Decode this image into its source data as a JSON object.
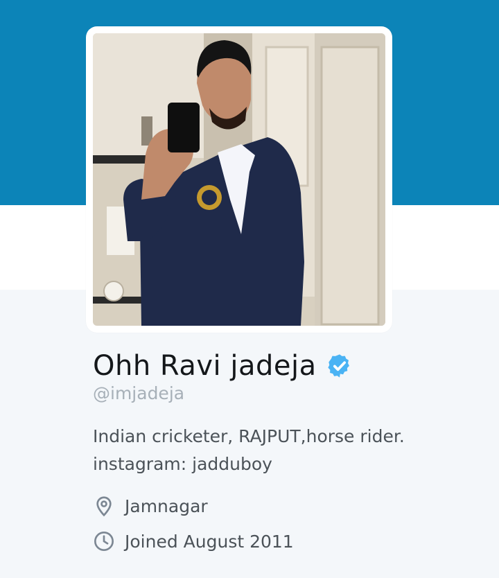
{
  "colors": {
    "banner": "#0c84b8",
    "profile_background": "#f4f7fa",
    "verified_badge": "#4ab3f4",
    "handle_text": "#a7b0b8",
    "meta_icon": "#7c8793"
  },
  "profile": {
    "avatar_icon": "profile-photo",
    "display_name": "Ohh Ravi jadeja",
    "verified": true,
    "handle": "@imjadeja",
    "bio_lines": [
      "Indian cricketer, RAJPUT,horse rider.",
      "instagram: jadduboy"
    ],
    "location": "Jamnagar",
    "location_icon": "map-pin-icon",
    "joined": "Joined August 2011",
    "joined_icon": "clock-icon"
  }
}
